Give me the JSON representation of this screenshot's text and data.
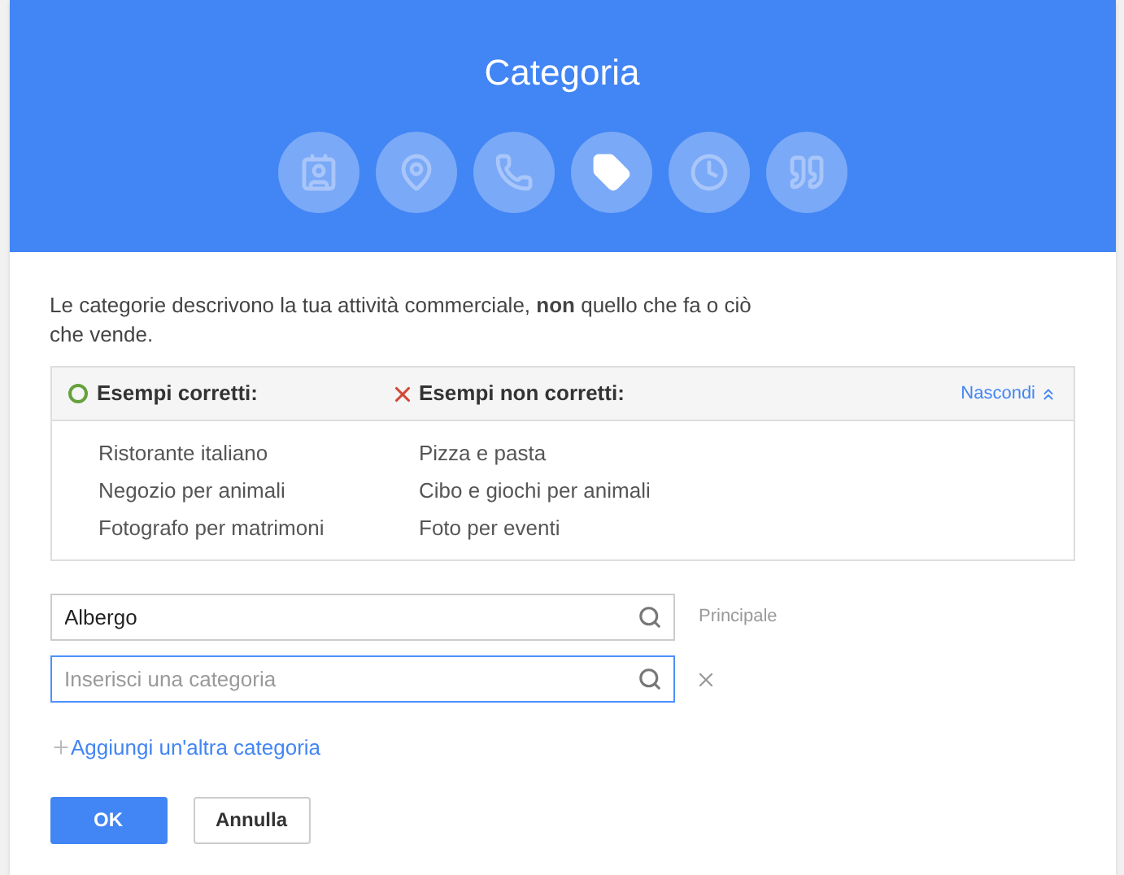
{
  "dialog": {
    "title": "Categoria",
    "steps": [
      {
        "kind": "card",
        "selected": false
      },
      {
        "kind": "pin",
        "selected": false
      },
      {
        "kind": "phone",
        "selected": false
      },
      {
        "kind": "tag",
        "selected": true
      },
      {
        "kind": "clock",
        "selected": false
      },
      {
        "kind": "quote",
        "selected": false
      }
    ],
    "intro": "Le categorie descrivono la tua attività commerciale, **non** quello che fa o ciò che vende.",
    "examples": {
      "good_title": "Esempi corretti:",
      "bad_title": "Esempi non corretti:",
      "toggle": "Nascondi",
      "good": [
        "Ristorante italiano",
        "Negozio per animali",
        "Fotografo per matrimoni"
      ],
      "bad": [
        "Pizza e pasta",
        "Cibo e giochi per animali",
        "Foto per eventi"
      ]
    },
    "fields": [
      {
        "value": "Albergo",
        "focused": false,
        "note": "Principale"
      },
      {
        "placeholder": "Inserisci una categoria",
        "focused": true,
        "removable": true
      }
    ],
    "add_link": "Aggiungi un'altra categoria",
    "buttons": [
      {
        "label": "OK",
        "kind": "primary"
      },
      {
        "label": "Annulla",
        "kind": "secondary"
      }
    ]
  }
}
